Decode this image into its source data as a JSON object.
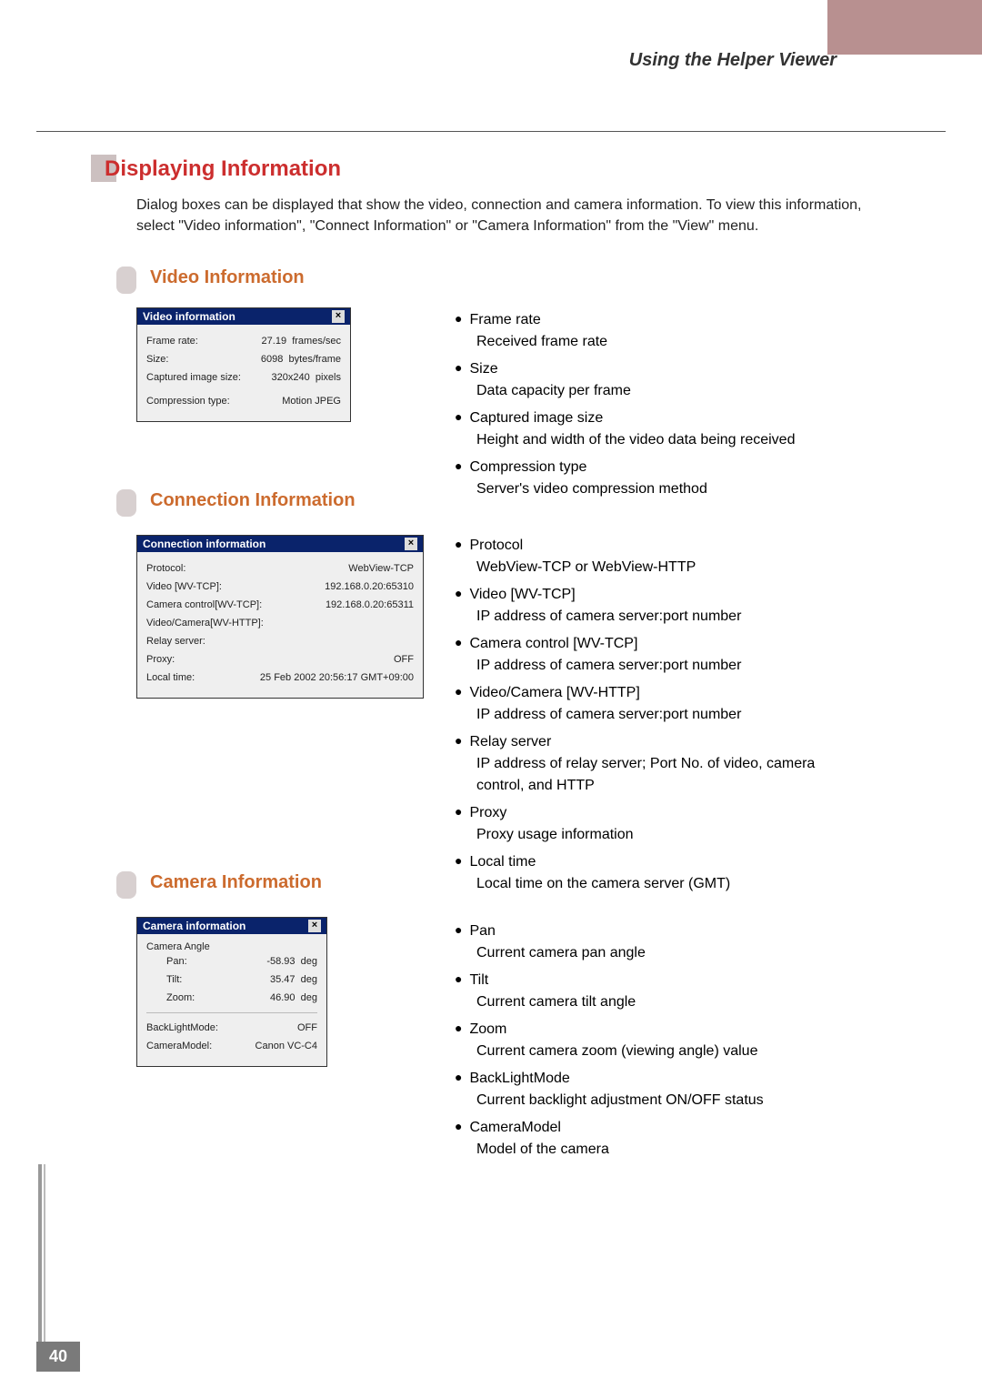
{
  "header": {
    "title": "Using the Helper Viewer"
  },
  "h1": "Displaying Information",
  "intro": "Dialog boxes can be displayed that show the video, connection and camera information. To view this information, select \"Video information\", \"Connect Information\" or \"Camera Information\" from the \"View\" menu.",
  "page_number": "40",
  "sections": {
    "video": {
      "title": "Video Information",
      "dialog": {
        "title": "Video information",
        "rows": [
          {
            "label": "Frame rate:",
            "value": "27.19",
            "unit": "frames/sec"
          },
          {
            "label": "Size:",
            "value": "6098",
            "unit": "bytes/frame"
          },
          {
            "label": "Captured image size:",
            "value": "320x240",
            "unit": "pixels"
          },
          {
            "label": "Compression type:",
            "value": "Motion JPEG",
            "unit": ""
          }
        ]
      },
      "bullets": [
        {
          "term": "Frame rate",
          "desc": "Received frame rate"
        },
        {
          "term": "Size",
          "desc": "Data capacity per frame"
        },
        {
          "term": "Captured image size",
          "desc": "Height and width of the video data being received"
        },
        {
          "term": "Compression type",
          "desc": "Server's video compression method"
        }
      ]
    },
    "connection": {
      "title": "Connection Information",
      "dialog": {
        "title": "Connection information",
        "rows": [
          {
            "label": "Protocol:",
            "value": "WebView-TCP"
          },
          {
            "label": "Video [WV-TCP]:",
            "value": "192.168.0.20:65310"
          },
          {
            "label": "Camera control[WV-TCP]:",
            "value": "192.168.0.20:65311"
          },
          {
            "label": "Video/Camera[WV-HTTP]:",
            "value": ""
          },
          {
            "label": "Relay server:",
            "value": ""
          },
          {
            "label": "Proxy:",
            "value": "OFF"
          },
          {
            "label": "Local time:",
            "value": "25 Feb 2002  20:56:17  GMT+09:00"
          }
        ]
      },
      "bullets": [
        {
          "term": "Protocol",
          "desc": "WebView-TCP or WebView-HTTP"
        },
        {
          "term": "Video [WV-TCP]",
          "desc": "IP address of camera server:port number"
        },
        {
          "term": "Camera control [WV-TCP]",
          "desc": "IP address of camera server:port number"
        },
        {
          "term": "Video/Camera [WV-HTTP]",
          "desc": "IP address of camera server:port number"
        },
        {
          "term": "Relay server",
          "desc": "IP address of relay server; Port No. of video, camera control, and HTTP"
        },
        {
          "term": "Proxy",
          "desc": "Proxy usage information"
        },
        {
          "term": "Local time",
          "desc": "Local time on the camera server (GMT)"
        }
      ]
    },
    "camera": {
      "title": "Camera Information",
      "dialog": {
        "title": "Camera information",
        "angle_label": "Camera Angle",
        "angle_rows": [
          {
            "label": "Pan:",
            "value": "-58.93",
            "unit": "deg"
          },
          {
            "label": "Tilt:",
            "value": "35.47",
            "unit": "deg"
          },
          {
            "label": "Zoom:",
            "value": "46.90",
            "unit": "deg"
          }
        ],
        "extra_rows": [
          {
            "label": "BackLightMode:",
            "value": "OFF"
          },
          {
            "label": "CameraModel:",
            "value": "Canon VC-C4"
          }
        ]
      },
      "bullets": [
        {
          "term": "Pan",
          "desc": "Current camera pan angle"
        },
        {
          "term": "Tilt",
          "desc": "Current camera tilt angle"
        },
        {
          "term": "Zoom",
          "desc": "Current camera zoom (viewing angle) value"
        },
        {
          "term": "BackLightMode",
          "desc": "Current backlight adjustment ON/OFF status"
        },
        {
          "term": "CameraModel",
          "desc": "Model of the camera"
        }
      ]
    }
  }
}
